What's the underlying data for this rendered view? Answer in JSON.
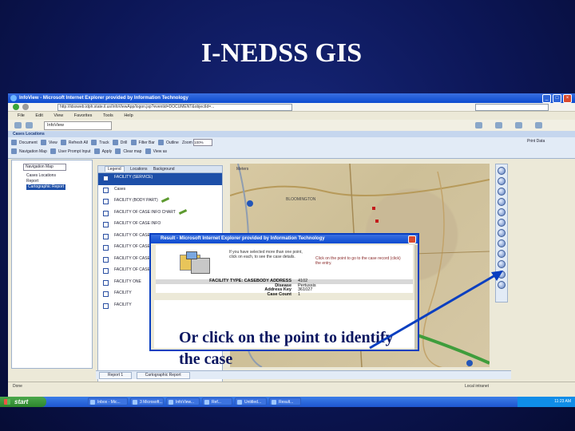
{
  "slide": {
    "title": "I-NEDSS GIS"
  },
  "browser": {
    "title": "InfoView - Microsoft Internet Explorer provided by Information Technology",
    "address": "http://idssweb.idph.state.il.us/InfoViewApp/logon.jsp?eventid=DOCUMENT&objectId=...",
    "menu": [
      "File",
      "Edit",
      "View",
      "Favorites",
      "Tools",
      "Help"
    ],
    "tab_label": "InfoView",
    "app_header": "Cases Locations",
    "toolbar": {
      "row1": [
        "Document",
        "View",
        "Refresh All",
        "Track",
        "Drill",
        "Filter Bar",
        "Outline"
      ],
      "zoom_label": "Zoom",
      "zoom_value": "100%",
      "print_label": "Print Data"
    },
    "toolbar_row2": [
      "Navigation Map",
      "User Prompt Input",
      "Apply",
      "Clear map",
      "View as"
    ],
    "left_panel": {
      "dropdown": "Navigation Map",
      "items": [
        "Cases Locations",
        "Report",
        "Cartographic Report"
      ],
      "selected_index": 2
    },
    "layer_tabs": [
      "Legend",
      "Locations",
      "Background"
    ],
    "layers": [
      {
        "label": "FACILITY (SERVICE)",
        "highlighted": true
      },
      {
        "label": "Cases",
        "highlighted": false
      },
      {
        "label": "FACILITY (BODY PART)",
        "highlighted": false
      },
      {
        "label": "FACILITY OF CASE INFO CHART",
        "highlighted": false
      },
      {
        "label": "FACILITY OF CASE INFO",
        "highlighted": false
      },
      {
        "label": "FACILITY OF CASE CATEGORY",
        "highlighted": false
      },
      {
        "label": "FACILITY OF CASE RECORD",
        "highlighted": false
      },
      {
        "label": "FACILITY OF CASE",
        "highlighted": false
      },
      {
        "label": "FACILITY OF CASE",
        "highlighted": false
      },
      {
        "label": "FACILITY ONE",
        "highlighted": false
      },
      {
        "label": "FACILITY",
        "highlighted": false
      },
      {
        "label": "FACILITY",
        "highlighted": false
      }
    ],
    "map": {
      "scale_label": "Meters",
      "place_label": "BLOOMINGTON"
    },
    "bottom_tabs": [
      "Report 1",
      "Cartographic Report"
    ],
    "status": {
      "left": "Done",
      "zone": "Local intranet"
    }
  },
  "popup": {
    "title": "Result - Microsoft Internet Explorer provided by Information Technology",
    "message1": "If you have selected more than one point, click on each, to see the case details.",
    "message2": "Click on the point to go to the case record (click) the entry.",
    "record": [
      {
        "key": "FACILITY TYPE: CASEBODY ADDRESS",
        "value": "4102"
      },
      {
        "key": "Disease",
        "value": "Pertussis"
      },
      {
        "key": "Address Key",
        "value": "361027"
      },
      {
        "key": "Case Count",
        "value": "1"
      }
    ],
    "caption": "Or click on the point to identify the case"
  },
  "taskbar": {
    "start_label": "start",
    "tasks": [
      "Inbox - Mic...",
      "3 Microsoft...",
      "InfoView...",
      "Ref...",
      "Untitled...",
      "Result..."
    ],
    "clock": "11:23 AM"
  },
  "colors": {
    "slide_bg": "#0c1656",
    "title": "#ffffff",
    "caption": "#0a1660",
    "arrow": "#0a3fc0"
  }
}
